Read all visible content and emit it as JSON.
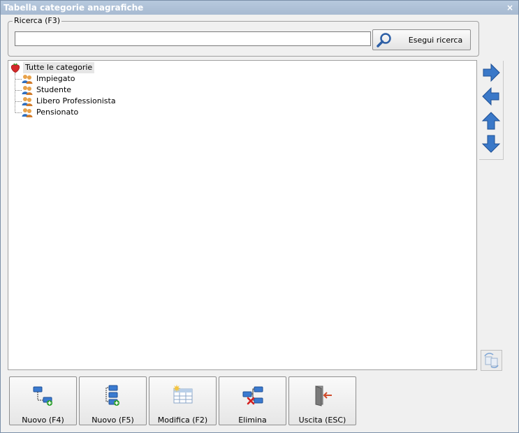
{
  "window": {
    "title": "Tabella categorie anagrafiche",
    "close_glyph": "×"
  },
  "search": {
    "group_label": "Ricerca (F3)",
    "value": "",
    "placeholder": "",
    "button_label": "Esegui ricerca",
    "button_icon": "search-icon"
  },
  "tree": {
    "root": {
      "label": "Tutte le categorie",
      "icon": "strawberry-icon"
    },
    "items": [
      {
        "label": "Impiegato",
        "icon": "users-icon"
      },
      {
        "label": "Studente",
        "icon": "users-icon"
      },
      {
        "label": "Libero Professionista",
        "icon": "users-icon"
      },
      {
        "label": "Pensionato",
        "icon": "users-icon"
      }
    ]
  },
  "side_buttons": [
    "arrow-right-icon",
    "arrow-left-icon",
    "arrow-up-icon",
    "arrow-down-icon"
  ],
  "bottom_buttons": [
    {
      "label": "Nuovo (F4)",
      "icon": "new-sibling-node-icon"
    },
    {
      "label": "Nuovo (F5)",
      "icon": "new-child-node-icon"
    },
    {
      "label": "Modifica (F2)",
      "icon": "edit-table-icon"
    },
    {
      "label": "Elimina",
      "icon": "delete-node-icon"
    },
    {
      "label": "Uscita (ESC)",
      "icon": "exit-door-icon"
    }
  ],
  "colors": {
    "arrow_blue": "#3a78c8",
    "title_bar": "#a9bcd3",
    "delete_red": "#d42020",
    "add_green": "#2a9e2a"
  }
}
